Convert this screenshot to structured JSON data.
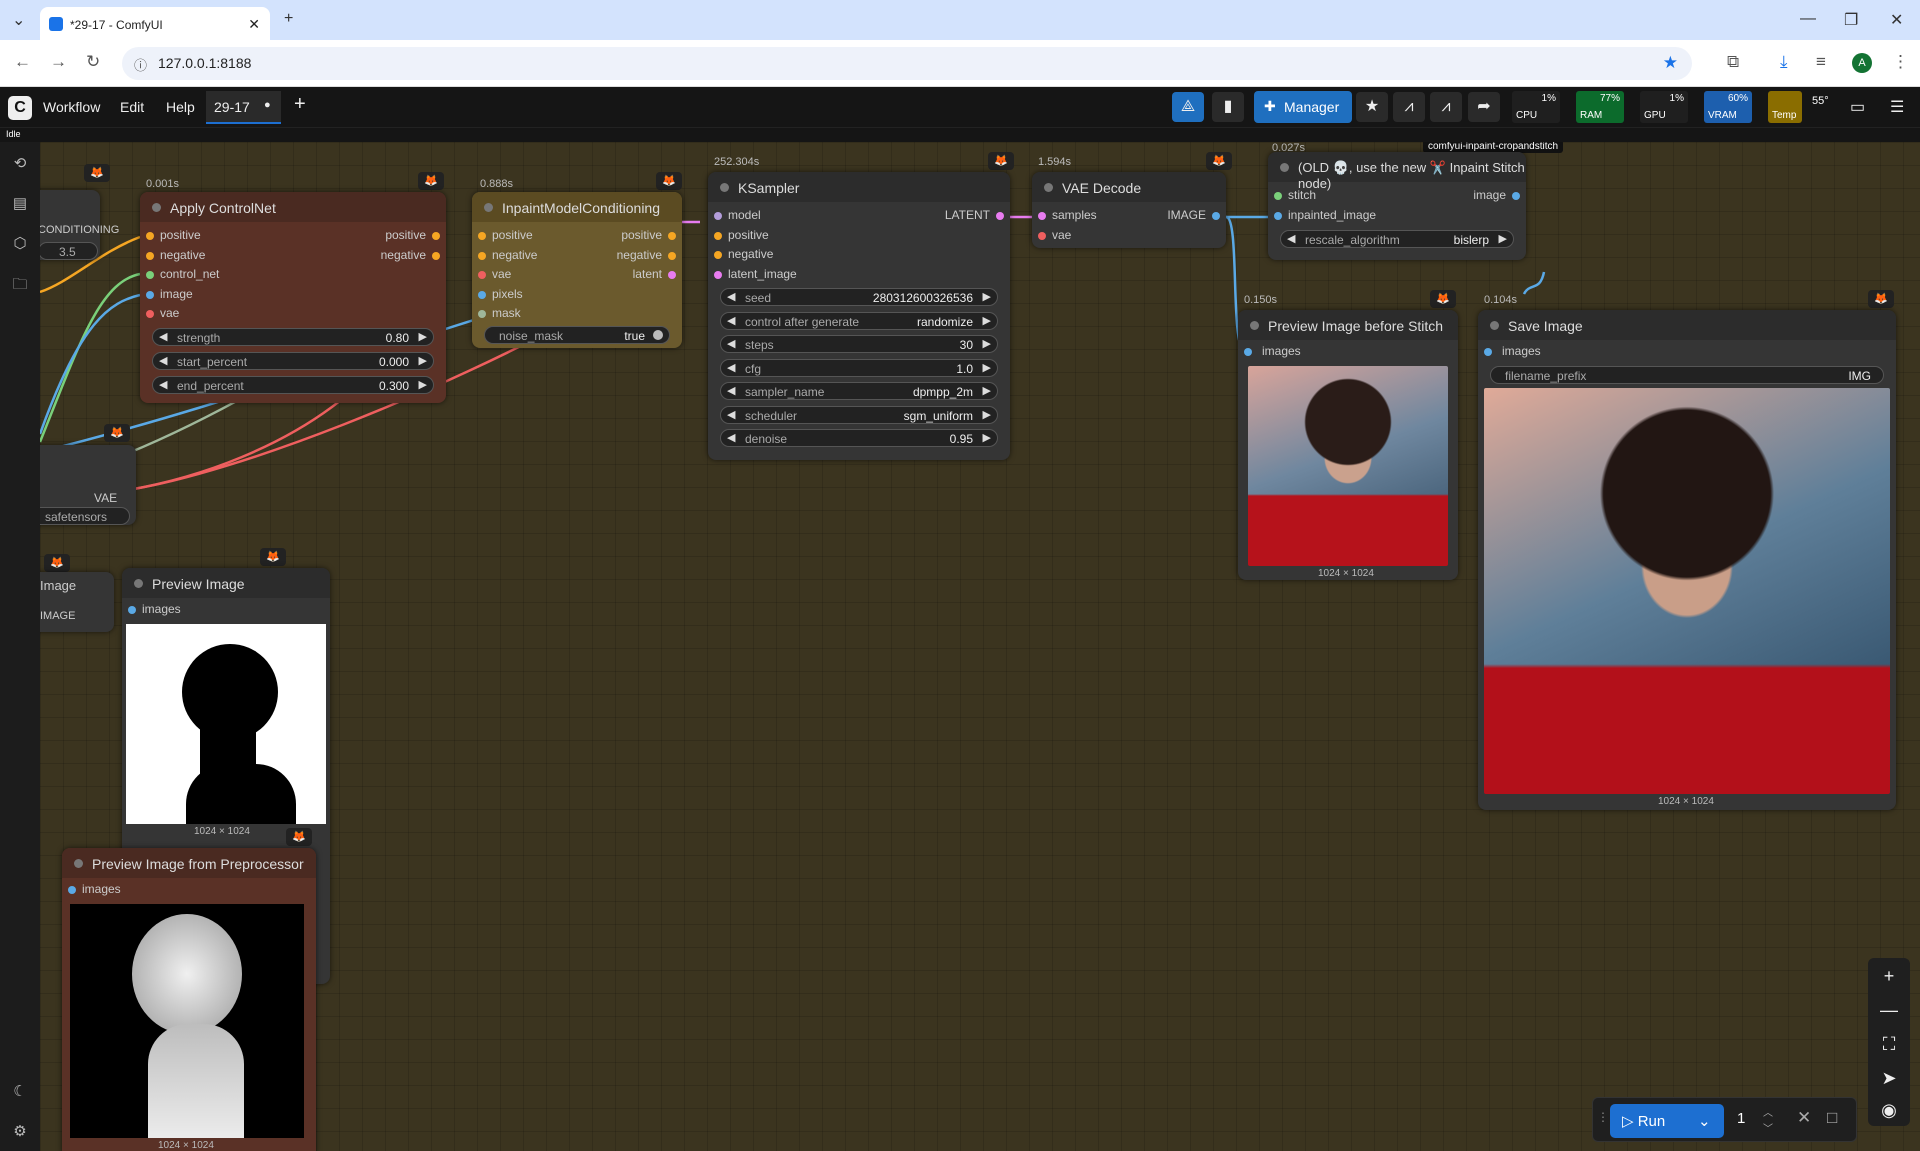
{
  "browser": {
    "tab_title": "*29-17 - ComfyUI",
    "url": "127.0.0.1:8188"
  },
  "menu": {
    "workflow": "Workflow",
    "edit": "Edit",
    "help": "Help",
    "open_tab": "29-17",
    "manager": "Manager"
  },
  "monitors": {
    "cpu": {
      "label": "CPU",
      "pct": "1%"
    },
    "ram": {
      "label": "RAM",
      "pct": "77%"
    },
    "gpu": {
      "label": "GPU",
      "pct": "1%"
    },
    "vram": {
      "label": "VRAM",
      "pct": "60%"
    },
    "temp": {
      "label": "Temp",
      "pct": "55°"
    }
  },
  "status": "Idle",
  "nodes": {
    "left_partial": {
      "conditioning_label": "CONDITIONING",
      "strength_value": "3.5",
      "vae_label": "VAE",
      "safetensors": "safetensors"
    },
    "apply_controlnet": {
      "timer": "0.001s",
      "title": "Apply ControlNet",
      "inputs": [
        "positive",
        "negative",
        "control_net",
        "image",
        "vae"
      ],
      "outputs": [
        "positive",
        "negative"
      ],
      "strength_label": "strength",
      "strength": "0.80",
      "start_label": "start_percent",
      "start": "0.000",
      "end_label": "end_percent",
      "end": "0.300"
    },
    "inpaint_cond": {
      "timer": "0.888s",
      "title": "InpaintModelConditioning",
      "inputs": [
        "positive",
        "negative",
        "vae",
        "pixels",
        "mask"
      ],
      "outputs": [
        "positive",
        "negative",
        "latent"
      ],
      "noise_mask_label": "noise_mask",
      "noise_mask": "true"
    },
    "ksampler": {
      "timer": "252.304s",
      "title": "KSampler",
      "inputs": [
        "model",
        "positive",
        "negative",
        "latent_image"
      ],
      "output": "LATENT",
      "seed_label": "seed",
      "seed": "280312600326536",
      "control_label": "control after generate",
      "control": "randomize",
      "steps_label": "steps",
      "steps": "30",
      "cfg_label": "cfg",
      "cfg": "1.0",
      "sampler_label": "sampler_name",
      "sampler": "dpmpp_2m",
      "scheduler_label": "scheduler",
      "scheduler": "sgm_uniform",
      "denoise_label": "denoise",
      "denoise": "0.95"
    },
    "vae_decode": {
      "timer": "1.594s",
      "title": "VAE Decode",
      "inputs": [
        "samples",
        "vae"
      ],
      "output": "IMAGE"
    },
    "inpaint_stitch": {
      "timer": "0.027s",
      "tooltip": "comfyui-inpaint-cropandstitch",
      "title": "(OLD 💀, use the new ✂️ Inpaint Stitch node)",
      "inputs": [
        "stitch",
        "inpainted_image"
      ],
      "output": "image",
      "rescale_label": "rescale_algorithm",
      "rescale": "bislerp"
    },
    "preview_before_stitch": {
      "timer": "0.150s",
      "title": "Preview Image before Stitch",
      "input": "images",
      "size": "1024 × 1024"
    },
    "save_image": {
      "timer": "0.104s",
      "title": "Save Image",
      "input": "images",
      "prefix_label": "filename_prefix",
      "prefix": "IMG",
      "size": "1024 × 1024"
    },
    "preview_image": {
      "title": "Preview Image",
      "input": "images",
      "size": "1024 × 1024",
      "left_label": "IMAGE",
      "left_title": "Image"
    },
    "preview_preprocessor": {
      "title": "Preview Image from Preprocessor",
      "input": "images",
      "size": "1024 × 1024"
    }
  },
  "run": {
    "label": "Run",
    "count": "1"
  },
  "colors": {
    "controlnet_node": "#5a3126",
    "inpaint_node": "#6b5a2d",
    "default_node": "#353535",
    "wire_red": "#ef5f5f",
    "wire_yellow": "#f5a623",
    "wire_pink": "#e87cf0",
    "wire_blue": "#5aa9e6",
    "wire_green": "#7ad07a"
  }
}
